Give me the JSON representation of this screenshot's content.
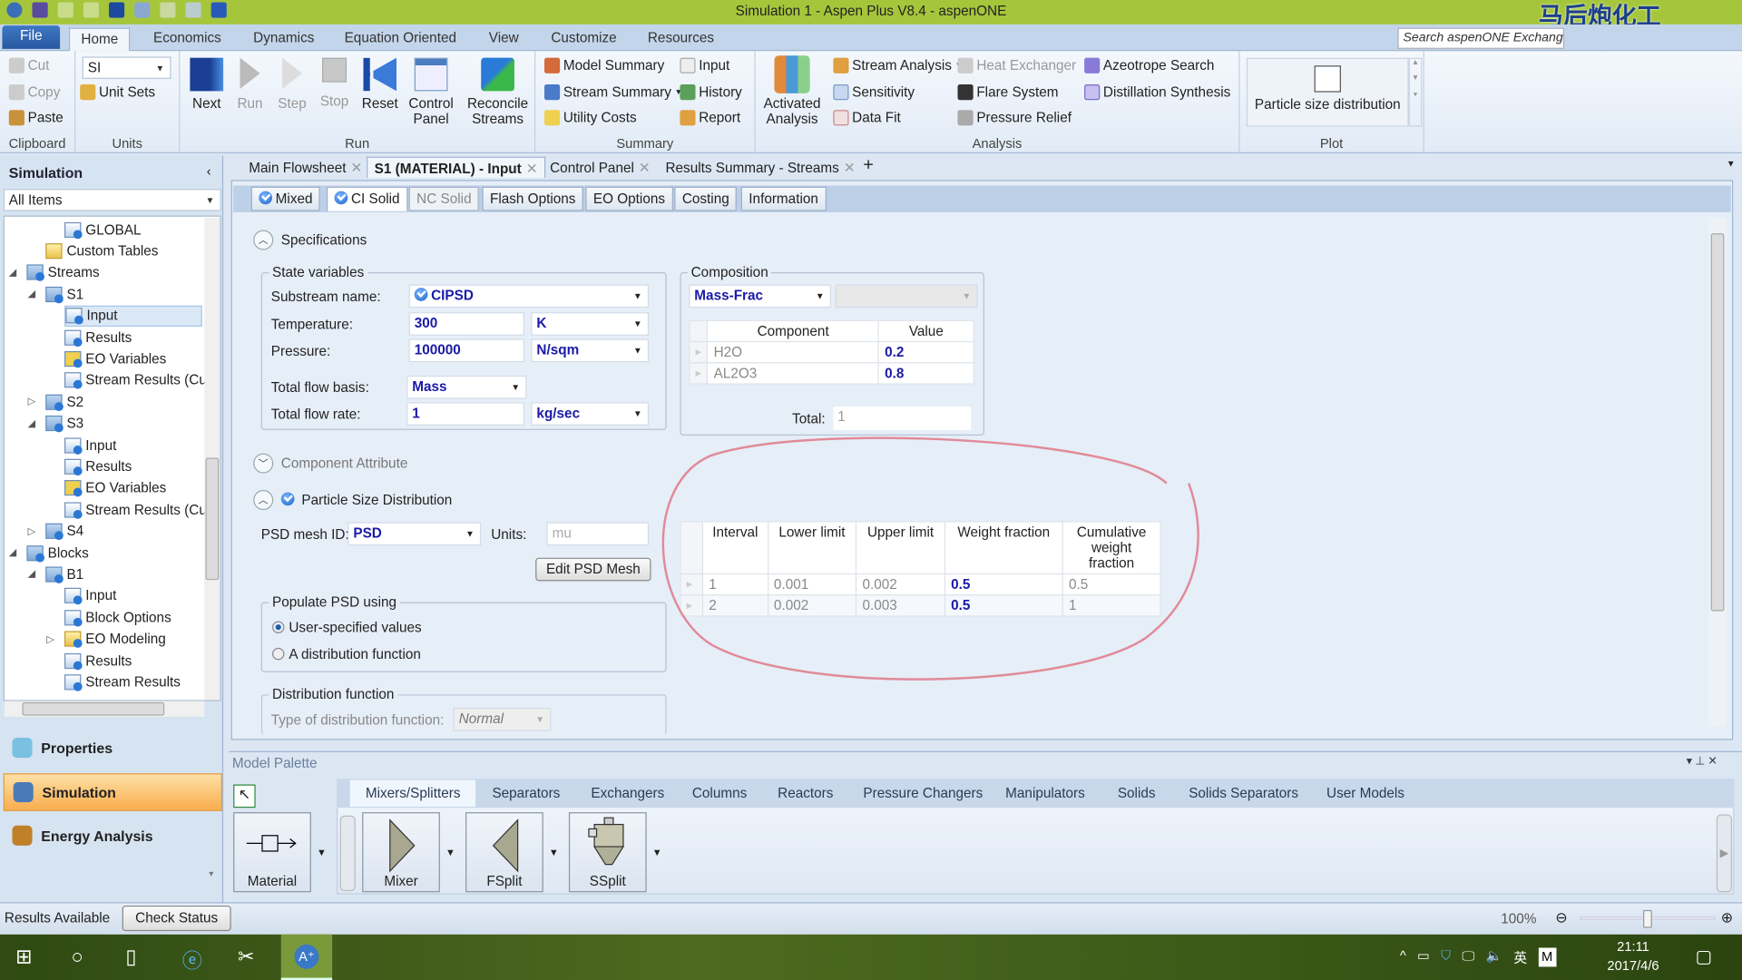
{
  "window": {
    "title": "Simulation 1 - Aspen Plus V8.4 - aspenONE",
    "watermark": "马后炮化工 Mahoupao.net"
  },
  "menu": {
    "tabs": [
      "File",
      "Home",
      "Economics",
      "Dynamics",
      "Equation Oriented",
      "View",
      "Customize",
      "Resources"
    ],
    "active": "Home",
    "search_placeholder": "Search aspenONE Exchange"
  },
  "ribbon": {
    "clipboard": {
      "label": "Clipboard",
      "cut": "Cut",
      "copy": "Copy",
      "paste": "Paste"
    },
    "units": {
      "label": "Units",
      "unit_set": "SI",
      "unit_sets": "Unit Sets"
    },
    "run": {
      "label": "Run",
      "next": "Next",
      "run": "Run",
      "step": "Step",
      "stop": "Stop",
      "reset": "Reset",
      "control_panel_1": "Control",
      "control_panel_2": "Panel",
      "reconcile_1": "Reconcile",
      "reconcile_2": "Streams"
    },
    "summary": {
      "label": "Summary",
      "model_summary": "Model Summary",
      "stream_summary": "Stream Summary",
      "utility_costs": "Utility Costs",
      "input": "Input",
      "history": "History",
      "report": "Report"
    },
    "analysis": {
      "label": "Analysis",
      "activated_1": "Activated",
      "activated_2": "Analysis",
      "stream_analysis": "Stream Analysis",
      "sensitivity": "Sensitivity",
      "data_fit": "Data Fit",
      "heat_exchanger": "Heat Exchanger",
      "flare_system": "Flare System",
      "pressure_relief": "Pressure Relief",
      "azeotrope_search": "Azeotrope Search",
      "distillation_synthesis": "Distillation Synthesis"
    },
    "plot": {
      "label": "Plot",
      "psd": "Particle size distribution"
    }
  },
  "sidebar": {
    "title": "Simulation",
    "filter": "All Items",
    "tree": [
      {
        "label": "GLOBAL",
        "icon": "form",
        "level": 3
      },
      {
        "label": "Custom Tables",
        "icon": "plain-folder",
        "level": 2
      },
      {
        "label": "Streams",
        "icon": "folder",
        "level": 1,
        "exp": "expanded"
      },
      {
        "label": "S1",
        "icon": "folder",
        "level": 2,
        "exp": "expanded"
      },
      {
        "label": "Input",
        "icon": "form",
        "level": 3,
        "selected": true
      },
      {
        "label": "Results",
        "icon": "results",
        "level": 3
      },
      {
        "label": "EO Variables",
        "icon": "eo",
        "level": 3
      },
      {
        "label": "Stream Results (Cus",
        "icon": "results",
        "level": 3
      },
      {
        "label": "S2",
        "icon": "folder",
        "level": 2,
        "exp": "collapsed"
      },
      {
        "label": "S3",
        "icon": "folder",
        "level": 2,
        "exp": "expanded"
      },
      {
        "label": "Input",
        "icon": "form",
        "level": 3
      },
      {
        "label": "Results",
        "icon": "results",
        "level": 3
      },
      {
        "label": "EO Variables",
        "icon": "eo",
        "level": 3
      },
      {
        "label": "Stream Results (Cus",
        "icon": "results",
        "level": 3
      },
      {
        "label": "S4",
        "icon": "folder",
        "level": 2,
        "exp": "collapsed"
      },
      {
        "label": "Blocks",
        "icon": "folder",
        "level": 1,
        "exp": "expanded"
      },
      {
        "label": "B1",
        "icon": "folder",
        "level": 2,
        "exp": "expanded"
      },
      {
        "label": "Input",
        "icon": "form",
        "level": 3
      },
      {
        "label": "Block Options",
        "icon": "form",
        "level": 3
      },
      {
        "label": "EO Modeling",
        "icon": "yfolder",
        "level": 3,
        "exp": "collapsed"
      },
      {
        "label": "Results",
        "icon": "results",
        "level": 3
      },
      {
        "label": "Stream Results",
        "icon": "results",
        "level": 3
      }
    ],
    "nav": [
      {
        "label": "Properties",
        "icon": "flask-icon"
      },
      {
        "label": "Simulation",
        "icon": "flowsheet-icon",
        "active": true
      },
      {
        "label": "Energy Analysis",
        "icon": "flame-icon"
      }
    ]
  },
  "doc_tabs": [
    {
      "label": "Main Flowsheet"
    },
    {
      "label": "S1 (MATERIAL) - Input",
      "active": true
    },
    {
      "label": "Control Panel"
    },
    {
      "label": "Results Summary - Streams"
    }
  ],
  "sheet_tabs": [
    {
      "label": "Mixed",
      "check": true
    },
    {
      "label": "CI Solid",
      "check": true,
      "active": true
    },
    {
      "label": "NC Solid",
      "disabled": true
    },
    {
      "label": "Flash Options"
    },
    {
      "label": "EO Options"
    },
    {
      "label": "Costing"
    },
    {
      "label": "Information"
    }
  ],
  "form": {
    "specifications": "Specifications",
    "state_variables": {
      "legend": "State variables",
      "substream_label": "Substream name:",
      "substream": "CIPSD",
      "temperature_label": "Temperature:",
      "temperature": "300",
      "temperature_unit": "K",
      "pressure_label": "Pressure:",
      "pressure": "100000",
      "pressure_unit": "N/sqm",
      "flow_basis_label": "Total flow basis:",
      "flow_basis": "Mass",
      "flow_rate_label": "Total flow rate:",
      "flow_rate": "1",
      "flow_rate_unit": "kg/sec"
    },
    "composition": {
      "legend": "Composition",
      "basis": "Mass-Frac",
      "headers": [
        "Component",
        "Value"
      ],
      "rows": [
        [
          "H2O",
          "0.2"
        ],
        [
          "AL2O3",
          "0.8"
        ]
      ],
      "total_label": "Total:",
      "total": "1"
    },
    "component_attribute": "Component Attribute",
    "psd": {
      "title": "Particle Size Distribution",
      "mesh_label": "PSD mesh ID:",
      "mesh": "PSD",
      "units_label": "Units:",
      "units": "mu",
      "edit_button": "Edit PSD Mesh",
      "headers": [
        "Interval",
        "Lower limit",
        "Upper limit",
        "Weight fraction",
        "Cumulative weight fraction"
      ],
      "rows": [
        [
          "1",
          "0.001",
          "0.002",
          "0.5",
          "0.5"
        ],
        [
          "2",
          "0.002",
          "0.003",
          "0.5",
          "1"
        ]
      ]
    },
    "populate": {
      "legend": "Populate PSD using",
      "options": [
        "User-specified values",
        "A distribution function"
      ],
      "selected": 0
    },
    "distribution": {
      "legend": "Distribution function",
      "type_label": "Type of distribution function:",
      "type": "Normal"
    }
  },
  "palette": {
    "title": "Model Palette",
    "tabs": [
      "Mixers/Splitters",
      "Separators",
      "Exchangers",
      "Columns",
      "Reactors",
      "Pressure Changers",
      "Manipulators",
      "Solids",
      "Solids Separators",
      "User Models"
    ],
    "active_tab": "Mixers/Splitters",
    "stream": "Material",
    "models": [
      "Mixer",
      "FSplit",
      "SSplit"
    ]
  },
  "status": {
    "text": "Results Available",
    "check_button": "Check Status",
    "zoom": "100%",
    "zoom_level": 0.5
  },
  "taskbar": {
    "time": "21:11",
    "date": "2017/4/6",
    "ime": "英",
    "ime_mode": "M"
  },
  "colors": {
    "titlebar": "#a5c63b",
    "value_text": "#1a1aa8",
    "active_nav": "#f9ad4d",
    "annotation": "#e07080"
  }
}
